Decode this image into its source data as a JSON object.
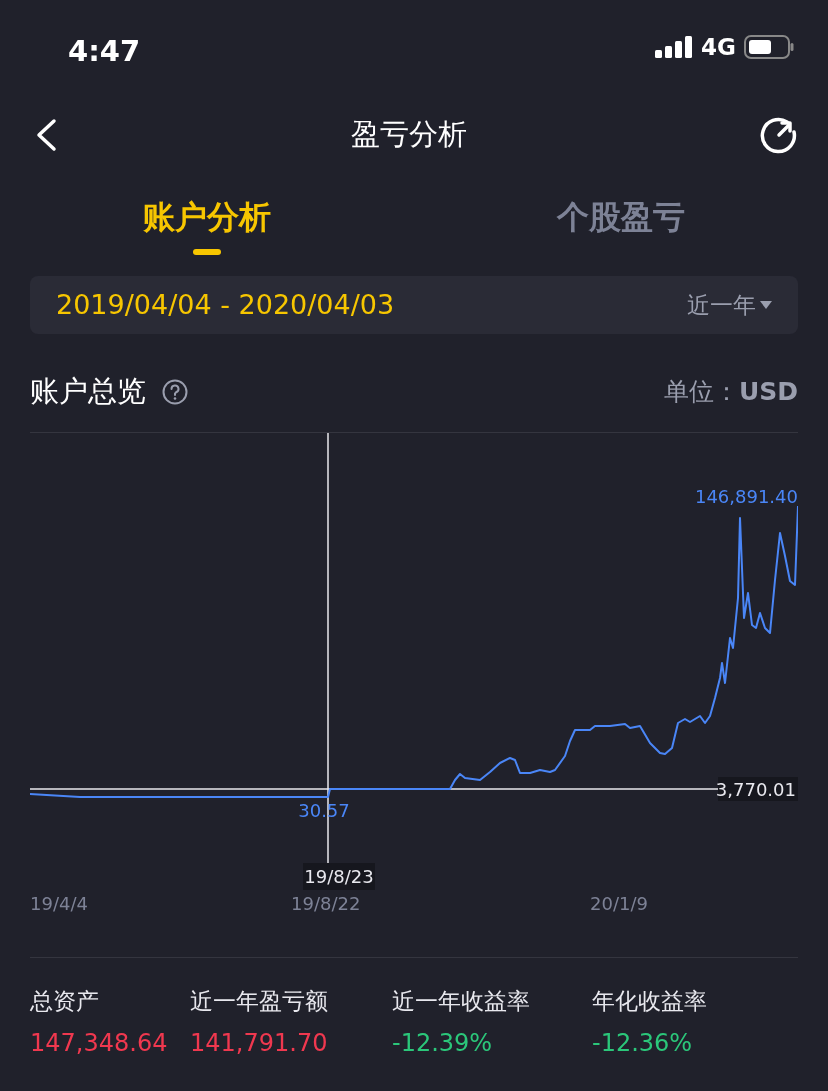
{
  "status_bar": {
    "time": "4:47",
    "network": "4G"
  },
  "nav": {
    "title": "盈亏分析"
  },
  "tabs": [
    {
      "label": "账户分析",
      "selected": true
    },
    {
      "label": "个股盈亏",
      "selected": false
    }
  ],
  "date_range": {
    "value": "2019/04/04 - 2020/04/03",
    "period": "近一年"
  },
  "section": {
    "title": "账户总览",
    "unit_label": "单位：",
    "unit": "USD"
  },
  "chart": {
    "max_label": "146,891.40",
    "cursor_value": "30.57",
    "cursor_date": "19/8/23",
    "reference_value": "3,770.01",
    "x_labels": [
      "19/4/4",
      "19/8/22",
      "20/1/9"
    ]
  },
  "stats": [
    {
      "label": "总资产",
      "value": "147,348.64",
      "color": "#f0384f"
    },
    {
      "label": "近一年盈亏额",
      "value": "141,791.70",
      "color": "#f0384f"
    },
    {
      "label": "近一年收益率",
      "value": "-12.39%",
      "color": "#2bc77a"
    },
    {
      "label": "年化收益率",
      "value": "-12.36%",
      "color": "#2bc77a"
    }
  ]
}
